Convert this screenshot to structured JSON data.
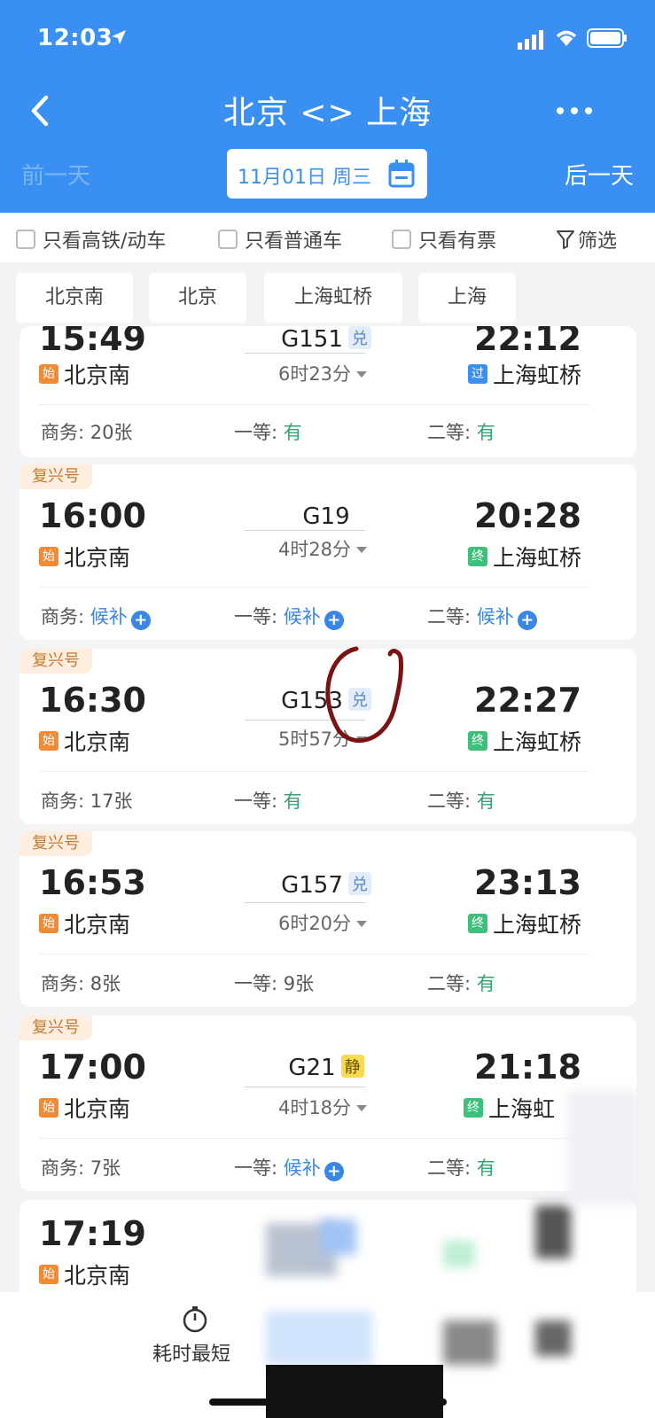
{
  "status": {
    "time": "12:03"
  },
  "header": {
    "title": "北京 <> 上海",
    "prev_day": "前一天",
    "next_day": "后一天",
    "date": "11月01日 周三"
  },
  "filters": {
    "high_speed": "只看高铁/动车",
    "regular": "只看普通车",
    "available": "只看有票",
    "filter_btn": "筛选"
  },
  "stations": [
    "北京南",
    "北京",
    "上海虹桥",
    "上海"
  ],
  "trains": [
    {
      "tag": "",
      "dep_time": "15:49",
      "arr_time": "22:12",
      "train_no": "G151",
      "badge": "兑",
      "duration": "6时23分",
      "dep_tag": "始",
      "dep_station": "北京南",
      "arr_tag": "过",
      "arr_station": "上海虹桥",
      "seat1_label": "商务:",
      "seat1_value": "20张",
      "seat2_label": "一等:",
      "seat2_value": "有",
      "seat3_label": "二等:",
      "seat3_value": "有"
    },
    {
      "tag": "复兴号",
      "dep_time": "16:00",
      "arr_time": "20:28",
      "train_no": "G19",
      "badge": "",
      "duration": "4时28分",
      "dep_tag": "始",
      "dep_station": "北京南",
      "arr_tag": "终",
      "arr_station": "上海虹桥",
      "seat1_label": "商务:",
      "seat1_value": "候补",
      "seat2_label": "一等:",
      "seat2_value": "候补",
      "seat3_label": "二等:",
      "seat3_value": "候补"
    },
    {
      "tag": "复兴号",
      "dep_time": "16:30",
      "arr_time": "22:27",
      "train_no": "G153",
      "badge": "兑",
      "duration": "5时57分",
      "dep_tag": "始",
      "dep_station": "北京南",
      "arr_tag": "终",
      "arr_station": "上海虹桥",
      "seat1_label": "商务:",
      "seat1_value": "17张",
      "seat2_label": "一等:",
      "seat2_value": "有",
      "seat3_label": "二等:",
      "seat3_value": "有"
    },
    {
      "tag": "复兴号",
      "dep_time": "16:53",
      "arr_time": "23:13",
      "train_no": "G157",
      "badge": "兑",
      "duration": "6时20分",
      "dep_tag": "始",
      "dep_station": "北京南",
      "arr_tag": "终",
      "arr_station": "上海虹桥",
      "seat1_label": "商务:",
      "seat1_value": "8张",
      "seat2_label": "一等:",
      "seat2_value": "9张",
      "seat3_label": "二等:",
      "seat3_value": "有"
    },
    {
      "tag": "复兴号",
      "dep_time": "17:00",
      "arr_time": "21:18",
      "train_no": "G21",
      "badge": "静",
      "duration": "4时18分",
      "dep_tag": "始",
      "dep_station": "北京南",
      "arr_tag": "终",
      "arr_station": "上海虹",
      "seat1_label": "商务:",
      "seat1_value": "7张",
      "seat2_label": "一等:",
      "seat2_value": "候补",
      "seat3_label": "二等:",
      "seat3_value": "有"
    },
    {
      "tag": "",
      "dep_time": "17:19",
      "dep_tag": "始",
      "dep_station": "北京南"
    }
  ],
  "bottom": {
    "sort_label": "耗时最短"
  },
  "colors": {
    "primary": "#3a90f2",
    "available": "#32a471",
    "waitlist": "#3a86e4",
    "annotation": "#7a1414"
  }
}
